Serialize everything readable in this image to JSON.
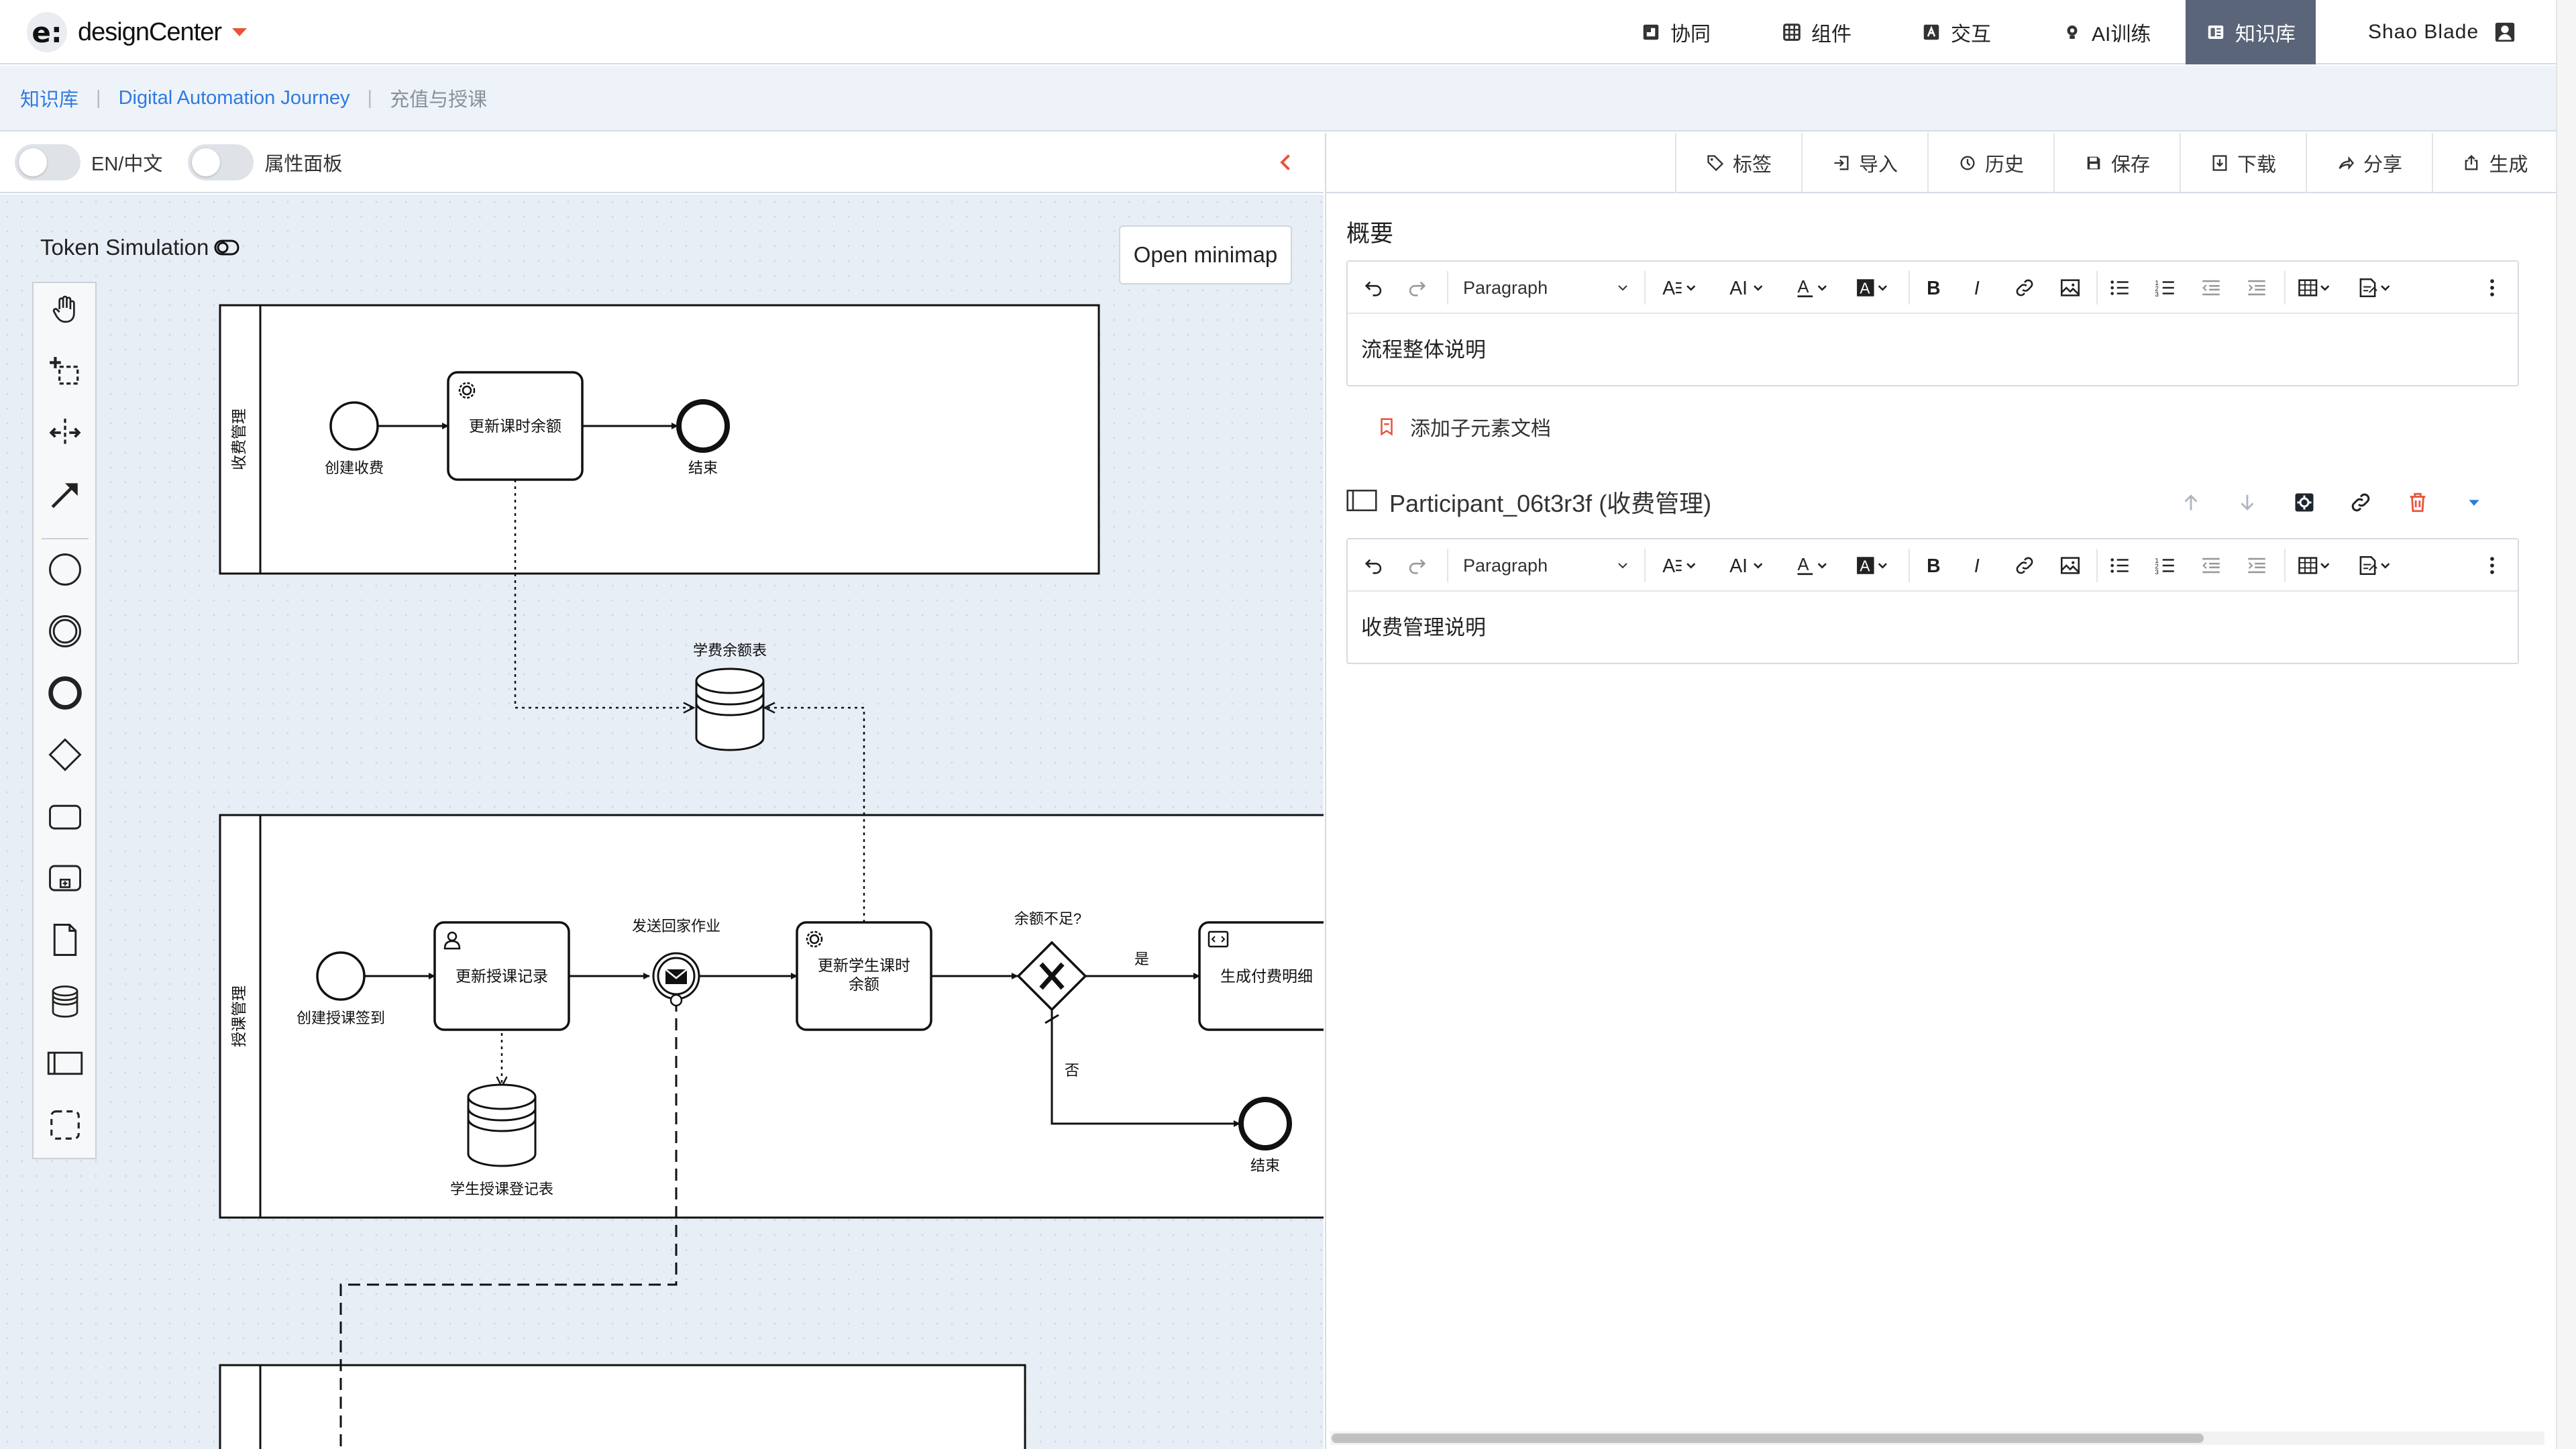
{
  "app": {
    "logo_letter": "e:",
    "logo_text": "designCenter"
  },
  "nav": {
    "items": [
      {
        "label": "协同",
        "icon": "puzzle-icon"
      },
      {
        "label": "组件",
        "icon": "grid-icon"
      },
      {
        "label": "交互",
        "icon": "interaction-icon"
      },
      {
        "label": "AI训练",
        "icon": "bulb-icon"
      },
      {
        "label": "知识库",
        "icon": "book-icon",
        "active": true
      }
    ],
    "user": "Shao Blade"
  },
  "breadcrumb": {
    "root": "知识库",
    "project": "Digital Automation Journey",
    "current": "充值与授课"
  },
  "left_toolbar": {
    "lang_label": "EN/中文",
    "props_label": "属性面板"
  },
  "canvas": {
    "token_simulation": "Token Simulation",
    "minimap_button": "Open minimap",
    "diagram": {
      "pool_fee_label": "收费管理",
      "pool_course_label": "授课管理",
      "start_fee": "创建收费",
      "task_update_balance": "更新课时余额",
      "end_fee": "结束",
      "datastore_balance": "学费余额表",
      "start_course": "创建授课签到",
      "task_update_record": "更新授课记录",
      "event_send_homework": "发送回家作业",
      "task_update_student_line1": "更新学生课时",
      "task_update_student_line2": "余额",
      "gateway_label": "余额不足?",
      "flow_yes": "是",
      "flow_no": "否",
      "task_generate_bill": "生成付费明细",
      "end_course": "结束",
      "datastore_record": "学生授课登记表"
    }
  },
  "right_toolbar": {
    "buttons": [
      "标签",
      "导入",
      "历史",
      "保存",
      "下载",
      "分享",
      "生成"
    ]
  },
  "doc": {
    "overview_title": "概要",
    "editor_format": "Paragraph",
    "overview_text": "流程整体说明",
    "add_child_doc": "添加子元素文档",
    "participant_title": "Participant_06t3r3f (收费管理)",
    "participant_text": "收费管理说明"
  },
  "colors": {
    "link": "#2f7ae0",
    "active_nav": "#5a6579",
    "accent_red": "#e8533a",
    "delete_red": "#e8533a",
    "dropdown_blue": "#2f7ae0"
  }
}
